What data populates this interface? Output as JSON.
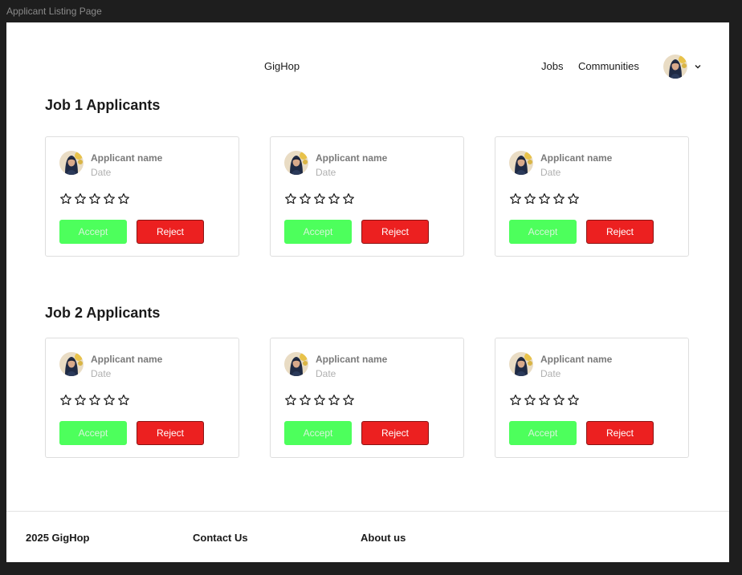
{
  "frame": {
    "label": "Applicant Listing Page"
  },
  "header": {
    "brand": "GigHop",
    "nav": [
      "Jobs",
      "Communities"
    ],
    "profile_icon": "avatar",
    "dropdown_icon": "chevron-down-icon"
  },
  "sections": [
    {
      "title": "Job 1 Applicants",
      "cards": [
        {
          "name": "Applicant name",
          "date": "Date",
          "rating": 0,
          "accept_label": "Accept",
          "reject_label": "Reject"
        },
        {
          "name": "Applicant name",
          "date": "Date",
          "rating": 0,
          "accept_label": "Accept",
          "reject_label": "Reject"
        },
        {
          "name": "Applicant name",
          "date": "Date",
          "rating": 0,
          "accept_label": "Accept",
          "reject_label": "Reject"
        }
      ]
    },
    {
      "title": "Job 2 Applicants",
      "cards": [
        {
          "name": "Applicant name",
          "date": "Date",
          "rating": 0,
          "accept_label": "Accept",
          "reject_label": "Reject"
        },
        {
          "name": "Applicant name",
          "date": "Date",
          "rating": 0,
          "accept_label": "Accept",
          "reject_label": "Reject"
        },
        {
          "name": "Applicant name",
          "date": "Date",
          "rating": 0,
          "accept_label": "Accept",
          "reject_label": "Reject"
        }
      ]
    }
  ],
  "footer": {
    "copyright": "2025 GigHop",
    "contact": "Contact Us",
    "about": "About us"
  },
  "colors": {
    "accept": "#4dff5c",
    "reject": "#ec2020",
    "canvas": "#1e1e1e"
  }
}
